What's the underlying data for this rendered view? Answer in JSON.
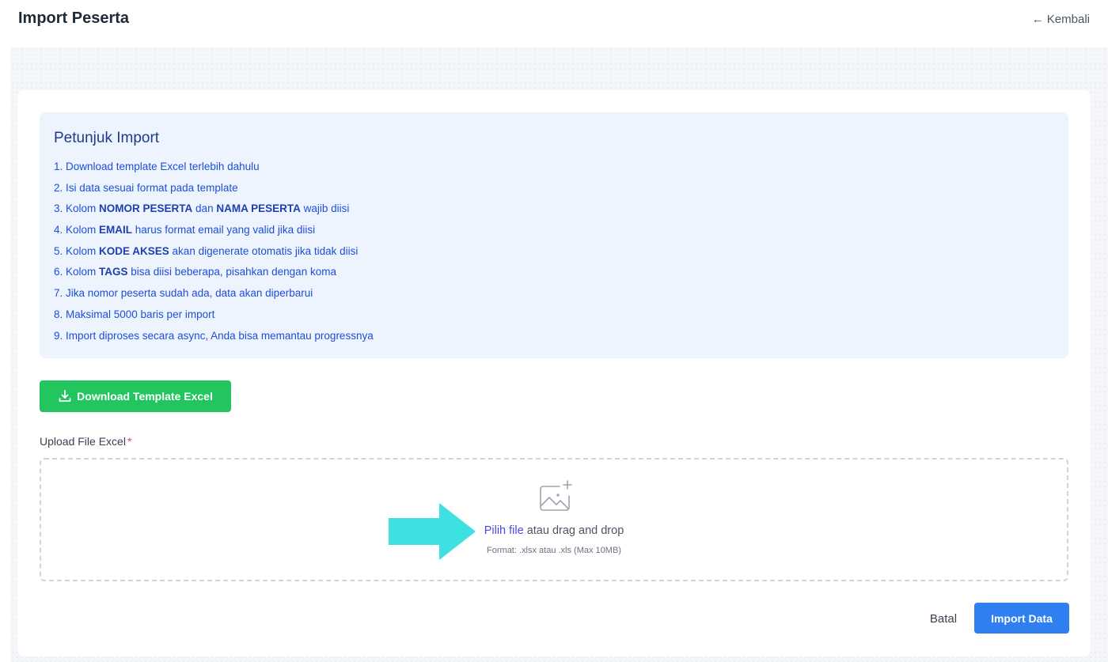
{
  "header": {
    "title": "Import Peserta",
    "back_arrow": "←",
    "back_label": "Kembali"
  },
  "guide": {
    "title": "Petunjuk Import",
    "items": [
      {
        "prefix": "1. Download template Excel terlebih dahulu",
        "bold1": "",
        "mid": "",
        "bold2": "",
        "suffix": ""
      },
      {
        "prefix": "2. Isi data sesuai format pada template",
        "bold1": "",
        "mid": "",
        "bold2": "",
        "suffix": ""
      },
      {
        "prefix": "3. Kolom ",
        "bold1": "NOMOR PESERTA",
        "mid": " dan ",
        "bold2": "NAMA PESERTA",
        "suffix": " wajib diisi"
      },
      {
        "prefix": "4. Kolom ",
        "bold1": "EMAIL",
        "mid": " harus format email yang valid jika diisi",
        "bold2": "",
        "suffix": ""
      },
      {
        "prefix": "5. Kolom ",
        "bold1": "KODE AKSES",
        "mid": " akan digenerate otomatis jika tidak diisi",
        "bold2": "",
        "suffix": ""
      },
      {
        "prefix": "6. Kolom ",
        "bold1": "TAGS",
        "mid": " bisa diisi beberapa, pisahkan dengan koma",
        "bold2": "",
        "suffix": ""
      },
      {
        "prefix": "7. Jika nomor peserta sudah ada, data akan diperbarui",
        "bold1": "",
        "mid": "",
        "bold2": "",
        "suffix": ""
      },
      {
        "prefix": "8. Maksimal 5000 baris per import",
        "bold1": "",
        "mid": "",
        "bold2": "",
        "suffix": ""
      },
      {
        "prefix": "9. Import diproses secara async, Anda bisa memantau progressnya",
        "bold1": "",
        "mid": "",
        "bold2": "",
        "suffix": ""
      }
    ]
  },
  "download_button": {
    "label": "Download Template Excel",
    "icon": "download-icon"
  },
  "upload": {
    "label": "Upload File Excel",
    "required_mark": "*",
    "icon": "image-add-icon",
    "link_text": "Pilih file",
    "rest_text": " atau drag and drop",
    "format_text": "Format: .xlsx atau .xls (Max 10MB)"
  },
  "actions": {
    "cancel_label": "Batal",
    "import_label": "Import Data"
  },
  "colors": {
    "primary": "#2f7ff0",
    "success": "#22c55e",
    "guide_bg": "#eef4fe",
    "guide_text": "#1d4ed8",
    "arrow": "#3fe0e0"
  }
}
